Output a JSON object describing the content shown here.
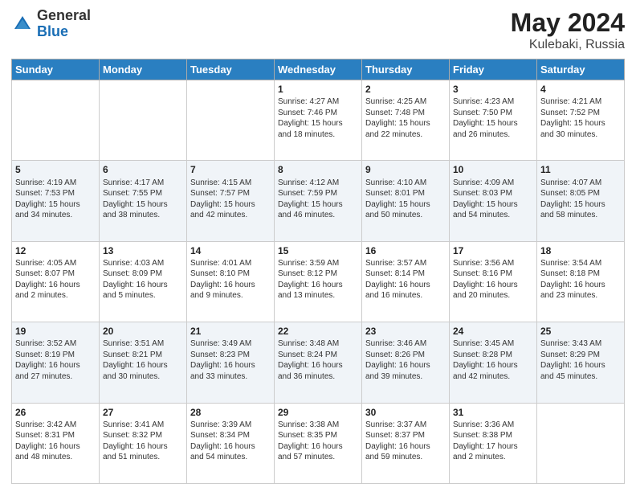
{
  "header": {
    "logo_general": "General",
    "logo_blue": "Blue",
    "main_title": "May 2024",
    "sub_title": "Kulebaki, Russia"
  },
  "calendar": {
    "weekdays": [
      "Sunday",
      "Monday",
      "Tuesday",
      "Wednesday",
      "Thursday",
      "Friday",
      "Saturday"
    ],
    "weeks": [
      [
        {
          "day": "",
          "info": ""
        },
        {
          "day": "",
          "info": ""
        },
        {
          "day": "",
          "info": ""
        },
        {
          "day": "1",
          "info": "Sunrise: 4:27 AM\nSunset: 7:46 PM\nDaylight: 15 hours and 18 minutes."
        },
        {
          "day": "2",
          "info": "Sunrise: 4:25 AM\nSunset: 7:48 PM\nDaylight: 15 hours and 22 minutes."
        },
        {
          "day": "3",
          "info": "Sunrise: 4:23 AM\nSunset: 7:50 PM\nDaylight: 15 hours and 26 minutes."
        },
        {
          "day": "4",
          "info": "Sunrise: 4:21 AM\nSunset: 7:52 PM\nDaylight: 15 hours and 30 minutes."
        }
      ],
      [
        {
          "day": "5",
          "info": "Sunrise: 4:19 AM\nSunset: 7:53 PM\nDaylight: 15 hours and 34 minutes."
        },
        {
          "day": "6",
          "info": "Sunrise: 4:17 AM\nSunset: 7:55 PM\nDaylight: 15 hours and 38 minutes."
        },
        {
          "day": "7",
          "info": "Sunrise: 4:15 AM\nSunset: 7:57 PM\nDaylight: 15 hours and 42 minutes."
        },
        {
          "day": "8",
          "info": "Sunrise: 4:12 AM\nSunset: 7:59 PM\nDaylight: 15 hours and 46 minutes."
        },
        {
          "day": "9",
          "info": "Sunrise: 4:10 AM\nSunset: 8:01 PM\nDaylight: 15 hours and 50 minutes."
        },
        {
          "day": "10",
          "info": "Sunrise: 4:09 AM\nSunset: 8:03 PM\nDaylight: 15 hours and 54 minutes."
        },
        {
          "day": "11",
          "info": "Sunrise: 4:07 AM\nSunset: 8:05 PM\nDaylight: 15 hours and 58 minutes."
        }
      ],
      [
        {
          "day": "12",
          "info": "Sunrise: 4:05 AM\nSunset: 8:07 PM\nDaylight: 16 hours and 2 minutes."
        },
        {
          "day": "13",
          "info": "Sunrise: 4:03 AM\nSunset: 8:09 PM\nDaylight: 16 hours and 5 minutes."
        },
        {
          "day": "14",
          "info": "Sunrise: 4:01 AM\nSunset: 8:10 PM\nDaylight: 16 hours and 9 minutes."
        },
        {
          "day": "15",
          "info": "Sunrise: 3:59 AM\nSunset: 8:12 PM\nDaylight: 16 hours and 13 minutes."
        },
        {
          "day": "16",
          "info": "Sunrise: 3:57 AM\nSunset: 8:14 PM\nDaylight: 16 hours and 16 minutes."
        },
        {
          "day": "17",
          "info": "Sunrise: 3:56 AM\nSunset: 8:16 PM\nDaylight: 16 hours and 20 minutes."
        },
        {
          "day": "18",
          "info": "Sunrise: 3:54 AM\nSunset: 8:18 PM\nDaylight: 16 hours and 23 minutes."
        }
      ],
      [
        {
          "day": "19",
          "info": "Sunrise: 3:52 AM\nSunset: 8:19 PM\nDaylight: 16 hours and 27 minutes."
        },
        {
          "day": "20",
          "info": "Sunrise: 3:51 AM\nSunset: 8:21 PM\nDaylight: 16 hours and 30 minutes."
        },
        {
          "day": "21",
          "info": "Sunrise: 3:49 AM\nSunset: 8:23 PM\nDaylight: 16 hours and 33 minutes."
        },
        {
          "day": "22",
          "info": "Sunrise: 3:48 AM\nSunset: 8:24 PM\nDaylight: 16 hours and 36 minutes."
        },
        {
          "day": "23",
          "info": "Sunrise: 3:46 AM\nSunset: 8:26 PM\nDaylight: 16 hours and 39 minutes."
        },
        {
          "day": "24",
          "info": "Sunrise: 3:45 AM\nSunset: 8:28 PM\nDaylight: 16 hours and 42 minutes."
        },
        {
          "day": "25",
          "info": "Sunrise: 3:43 AM\nSunset: 8:29 PM\nDaylight: 16 hours and 45 minutes."
        }
      ],
      [
        {
          "day": "26",
          "info": "Sunrise: 3:42 AM\nSunset: 8:31 PM\nDaylight: 16 hours and 48 minutes."
        },
        {
          "day": "27",
          "info": "Sunrise: 3:41 AM\nSunset: 8:32 PM\nDaylight: 16 hours and 51 minutes."
        },
        {
          "day": "28",
          "info": "Sunrise: 3:39 AM\nSunset: 8:34 PM\nDaylight: 16 hours and 54 minutes."
        },
        {
          "day": "29",
          "info": "Sunrise: 3:38 AM\nSunset: 8:35 PM\nDaylight: 16 hours and 57 minutes."
        },
        {
          "day": "30",
          "info": "Sunrise: 3:37 AM\nSunset: 8:37 PM\nDaylight: 16 hours and 59 minutes."
        },
        {
          "day": "31",
          "info": "Sunrise: 3:36 AM\nSunset: 8:38 PM\nDaylight: 17 hours and 2 minutes."
        },
        {
          "day": "",
          "info": ""
        }
      ]
    ]
  }
}
